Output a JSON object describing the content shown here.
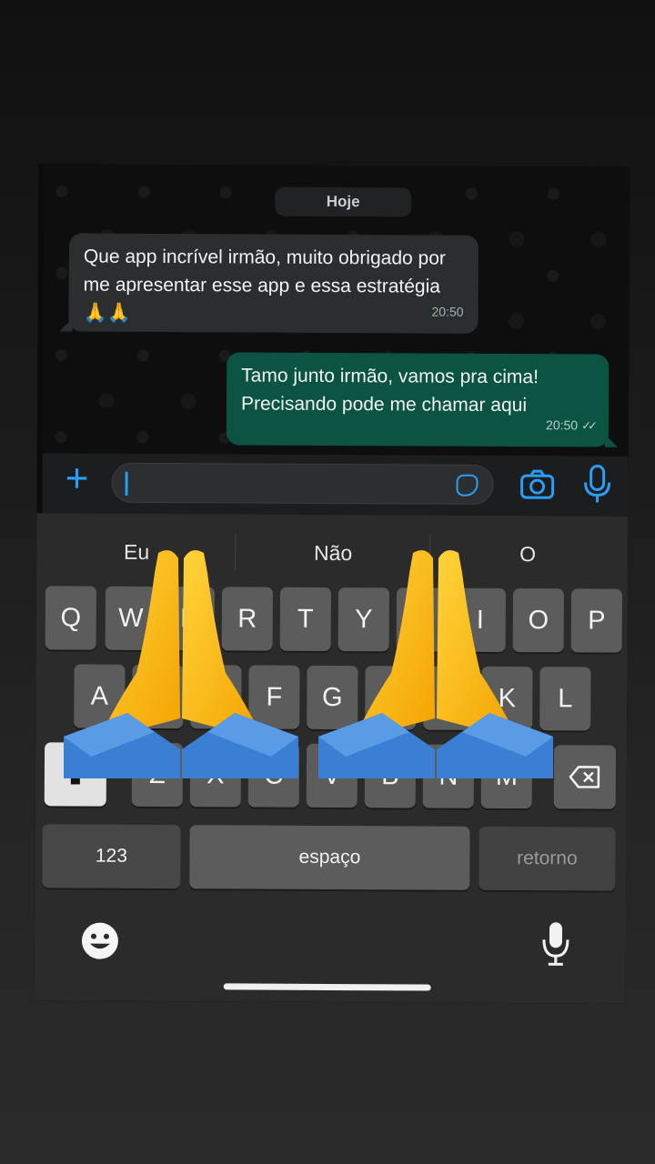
{
  "chat": {
    "date_label": "Hoje",
    "messages": [
      {
        "direction": "incoming",
        "text": "Que app incrível irmão, muito obrigado por me apresentar esse app e essa estratégia 🙏🙏",
        "time": "20:50"
      },
      {
        "direction": "outgoing",
        "text": "Tamo junto irmão, vamos pra cima! Precisando pode me chamar aqui",
        "time": "20:50",
        "status": "read"
      }
    ]
  },
  "input": {
    "placeholder": "",
    "value": ""
  },
  "suggestions": [
    "Eu",
    "Não",
    "O"
  ],
  "keyboard": {
    "row1": [
      "Q",
      "W",
      "E",
      "R",
      "T",
      "Y",
      "U",
      "I",
      "O",
      "P"
    ],
    "row2": [
      "A",
      "S",
      "D",
      "F",
      "G",
      "H",
      "J",
      "K",
      "L"
    ],
    "row3": [
      "Z",
      "X",
      "C",
      "V",
      "B",
      "N",
      "M"
    ],
    "numbers_label": "123",
    "space_label": "espaço",
    "return_label": "retorno"
  },
  "overlay": {
    "emoji": "folded-hands",
    "count": 2
  },
  "icons": [
    "plus-icon",
    "sticker-icon",
    "camera-icon",
    "mic-icon",
    "shift-icon",
    "backspace-icon",
    "emoji-icon",
    "dictation-icon"
  ],
  "colors": {
    "accent": "#2a9df4",
    "outgoing_bubble": "#0b5444",
    "incoming_bubble": "#2b2e30"
  }
}
